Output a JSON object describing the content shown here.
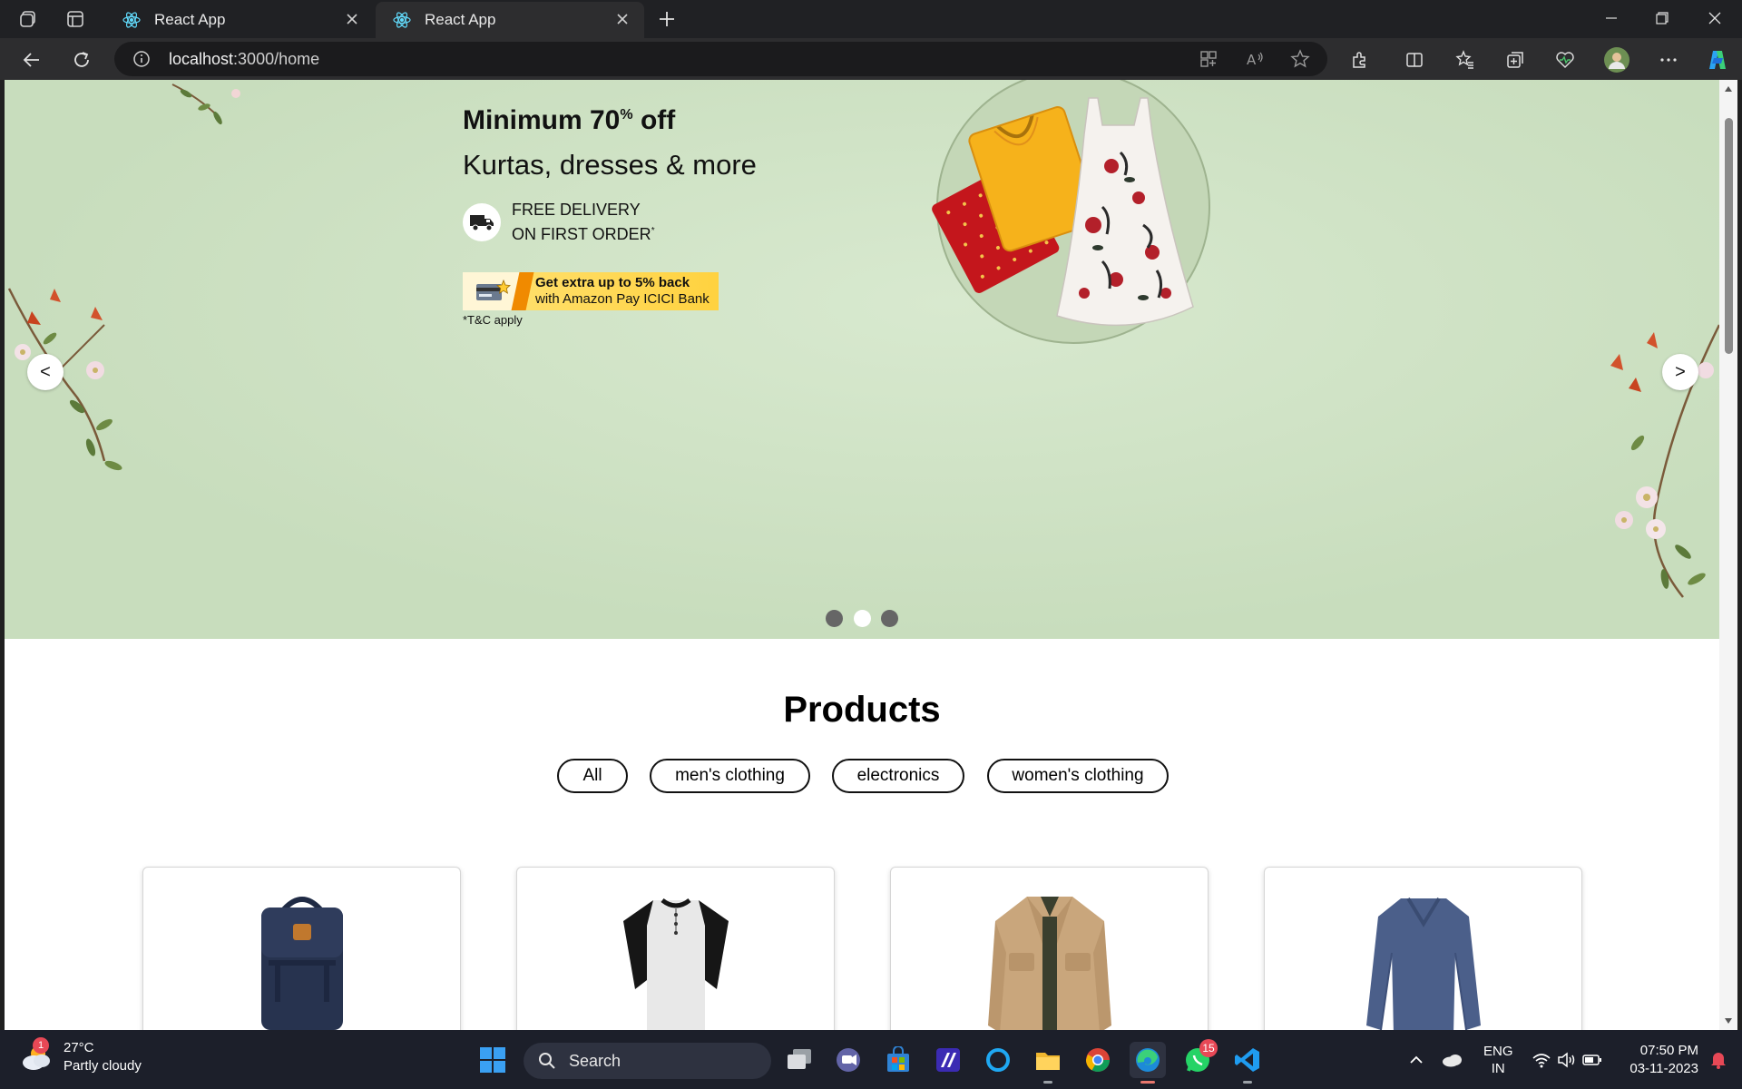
{
  "browser": {
    "tabs": [
      {
        "title": "React App",
        "active": false
      },
      {
        "title": "React App",
        "active": true
      }
    ],
    "url": {
      "host": "localhost",
      "path": ":3000/home"
    }
  },
  "banner": {
    "headline_main": "Minimum 70",
    "headline_sup": "%",
    "headline_end": " off",
    "subheadline": "Kurtas, dresses & more",
    "delivery_line1": "FREE DELIVERY",
    "delivery_line2": "ON FIRST ORDER",
    "delivery_mark": "*",
    "bank_line1": "Get extra up to 5% back",
    "bank_line2": "with Amazon Pay ICICI Bank",
    "tnc": "*T&C apply",
    "prev_label": "<",
    "next_label": ">",
    "slides": 3,
    "active_slide": 2
  },
  "products": {
    "heading": "Products",
    "filters": [
      "All",
      "men's clothing",
      "electronics",
      "women's clothing"
    ],
    "cards": [
      {
        "image": "backpack"
      },
      {
        "image": "henley-tshirt"
      },
      {
        "image": "jacket"
      },
      {
        "image": "long-sleeve-tshirt"
      }
    ]
  },
  "taskbar": {
    "weather_temp": "27°C",
    "weather_desc": "Partly cloudy",
    "weather_badge": "1",
    "search_label": "Search",
    "whatsapp_badge": "15",
    "lang_line1": "ENG",
    "lang_line2": "IN",
    "time": "07:50 PM",
    "date": "03-11-2023"
  },
  "colors": {
    "banner_bg": "#cfe2c5",
    "accent_yellow": "#ffd23f",
    "taskbar_bg": "#1c1f2a"
  }
}
